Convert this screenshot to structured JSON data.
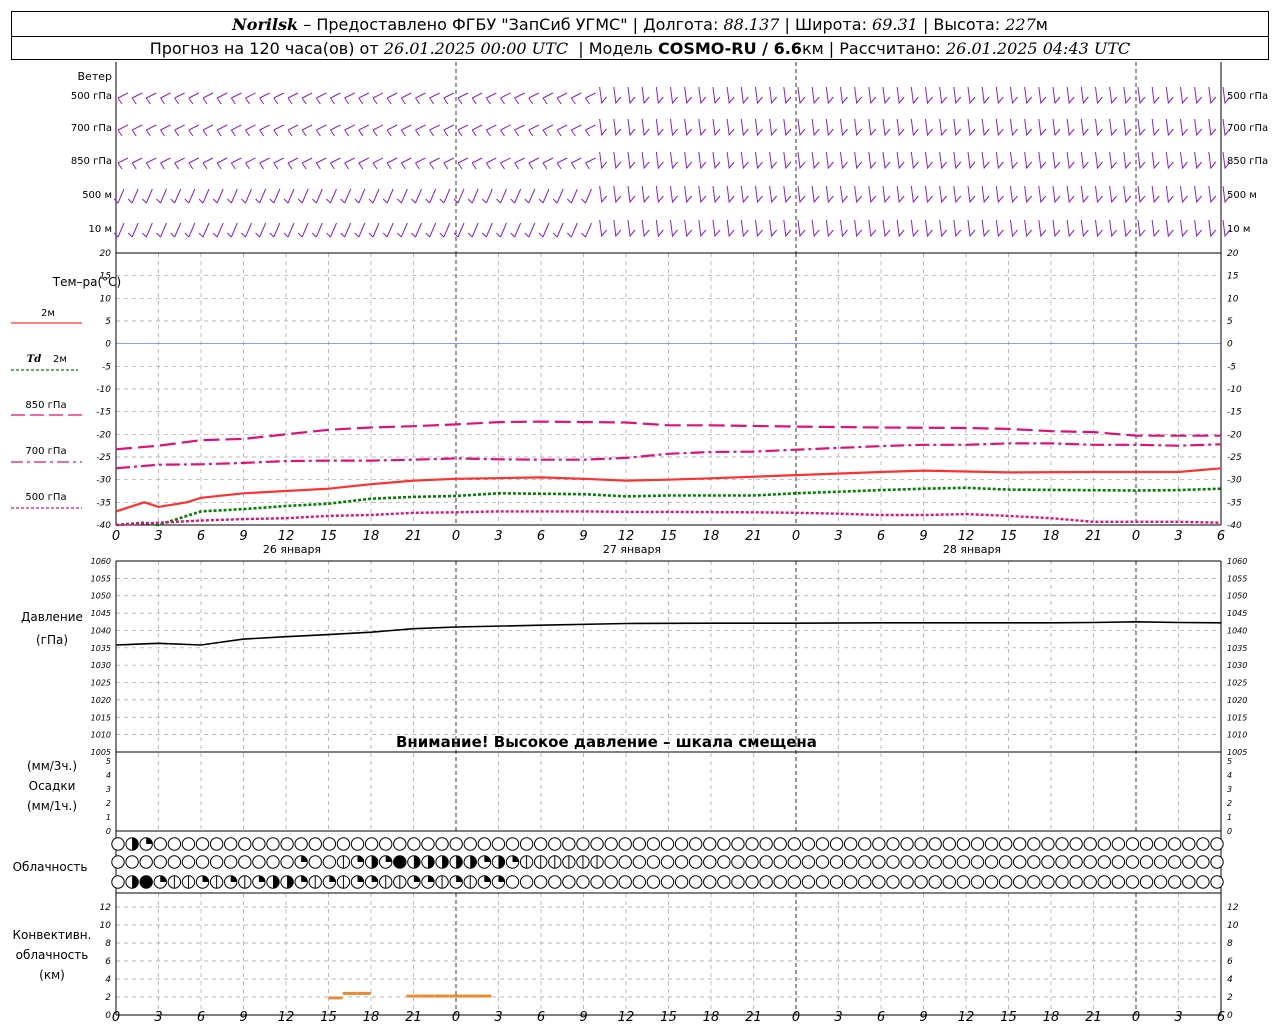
{
  "header": {
    "station": "Norilsk",
    "dash": "–",
    "provider": "Предоставлено ФГБУ \"ЗапСиб УГМС\"",
    "lon_label": "Долгота:",
    "lon": "88.137",
    "lat_label": "Широта:",
    "lat": "69.31",
    "alt_label": "Высота:",
    "alt": "227",
    "alt_unit": "м",
    "forecast_prefix": "Прогноз на 120 часа(ов) от",
    "forecast_from": "26.01.2025 00:00 UTC",
    "model_label": "Модель",
    "model": "COSMO-RU / 6.6",
    "model_unit": "км",
    "calc_label": "Рассчитано:",
    "calc_time": "26.01.2025 04:43 UTC"
  },
  "labels": {
    "wind": "Ветер",
    "levels": [
      "500 гПа",
      "700 гПа",
      "850 гПа",
      "500 м",
      "10 м"
    ],
    "temp": "Тем–ра(°C)",
    "t2m": "2м",
    "td_prefix": "Td",
    "td2m": "2м",
    "t850": "850 гПа",
    "t700": "700 гПа",
    "t500": "500 гПа",
    "pressure": "Давление",
    "pressure_unit": "(гПа)",
    "precip_unit1": "(мм/3ч.)",
    "precip": "Осадки",
    "precip_unit2": "(мм/1ч.)",
    "cloud": "Облачность",
    "conv1": "Конвективн.",
    "conv2": "облачность",
    "conv3": "(км)",
    "warning": "Внимание! Высокое давление – шкала смещена"
  },
  "colors": {
    "t2m": "#ff3030",
    "td2m": "#008000",
    "t850": "#e0107a",
    "t700": "#e0107a",
    "t500": "#e0107a",
    "pressure": "#000000",
    "wind": "#8a1cd0",
    "zero_line": "#4060ff",
    "conv": "#e88a30",
    "grid": "#a0a0a0"
  },
  "chart_data": {
    "type": "line",
    "x_hours": [
      0,
      3,
      6,
      9,
      12,
      15,
      18,
      21,
      24,
      27,
      30,
      33,
      36,
      39,
      42,
      45,
      48,
      51,
      54,
      57,
      60,
      63,
      66,
      69,
      72,
      75,
      78
    ],
    "x_tick_labels": [
      "0",
      "3",
      "6",
      "9",
      "12",
      "15",
      "18",
      "21",
      "0",
      "3",
      "6",
      "9",
      "12",
      "15",
      "18",
      "21",
      "0",
      "3",
      "6",
      "9",
      "12",
      "15",
      "18",
      "21",
      "0",
      "3",
      "6"
    ],
    "day_labels": [
      {
        "hour": 12,
        "text": "26 января"
      },
      {
        "hour": 36,
        "text": "27 января"
      },
      {
        "hour": 60,
        "text": "28 января"
      }
    ],
    "temperature": {
      "ylim": [
        -40,
        20
      ],
      "yticks": [
        20,
        15,
        10,
        5,
        0,
        -5,
        -10,
        -15,
        -20,
        -25,
        -30,
        -35,
        -40
      ],
      "series": [
        {
          "name": "2м",
          "key": "t2m",
          "x": [
            0,
            2,
            3,
            5,
            6,
            9,
            12,
            15,
            18,
            21,
            24,
            30,
            33,
            36,
            39,
            42,
            48,
            54,
            57,
            63,
            69,
            72,
            75,
            78
          ],
          "y": [
            -37,
            -35,
            -36,
            -35,
            -34,
            -33,
            -32.5,
            -32,
            -31,
            -30.2,
            -29.8,
            -29.5,
            -29.8,
            -30.2,
            -30,
            -29.7,
            -29,
            -28.3,
            -28,
            -28.4,
            -28.3,
            -28.3,
            -28.3,
            -27.5
          ]
        },
        {
          "name": "Td 2м",
          "key": "td2m",
          "x": [
            0,
            2,
            3,
            6,
            9,
            12,
            15,
            18,
            21,
            24,
            27,
            33,
            36,
            39,
            45,
            48,
            54,
            57,
            60,
            63,
            72,
            75,
            78
          ],
          "y": [
            -40,
            -39.5,
            -40,
            -37,
            -36.5,
            -35.8,
            -35.3,
            -34.2,
            -33.8,
            -33.6,
            -33,
            -33.2,
            -33.7,
            -33.5,
            -33.5,
            -33,
            -32.3,
            -32,
            -31.8,
            -32.2,
            -32.4,
            -32.3,
            -32
          ]
        },
        {
          "name": "850 гПа",
          "key": "t850",
          "x": [
            0,
            3,
            6,
            9,
            12,
            15,
            18,
            21,
            24,
            27,
            30,
            36,
            39,
            42,
            48,
            54,
            60,
            63,
            66,
            69,
            72,
            75,
            78
          ],
          "y": [
            -23.3,
            -22.5,
            -21.3,
            -21,
            -20,
            -19,
            -18.5,
            -18.2,
            -17.8,
            -17.3,
            -17.2,
            -17.4,
            -18,
            -18,
            -18.3,
            -18.5,
            -18.6,
            -18.8,
            -19.3,
            -19.5,
            -20.3,
            -20.3,
            -20.3
          ]
        },
        {
          "name": "700 гПа",
          "key": "t700",
          "x": [
            0,
            3,
            6,
            9,
            12,
            15,
            18,
            21,
            24,
            27,
            30,
            33,
            36,
            39,
            42,
            45,
            48,
            54,
            57,
            60,
            63,
            66,
            69,
            72,
            75,
            78
          ],
          "y": [
            -27.5,
            -26.7,
            -26.6,
            -26.3,
            -25.9,
            -25.8,
            -25.8,
            -25.6,
            -25.3,
            -25.5,
            -25.6,
            -25.6,
            -25.2,
            -24.3,
            -23.9,
            -23.8,
            -23.4,
            -22.6,
            -22.3,
            -22.3,
            -22.0,
            -22.0,
            -22.3,
            -22.3,
            -22.5,
            -22.2
          ]
        },
        {
          "name": "500 гПа",
          "key": "t500",
          "x": [
            0,
            3,
            6,
            9,
            12,
            15,
            18,
            21,
            24,
            27,
            33,
            36,
            39,
            45,
            48,
            51,
            54,
            57,
            60,
            63,
            66,
            69,
            72,
            75,
            78
          ],
          "y": [
            -40,
            -39.5,
            -39,
            -38.7,
            -38.5,
            -38,
            -37.8,
            -37.3,
            -37.2,
            -37,
            -37,
            -37.1,
            -37.1,
            -37.2,
            -37.3,
            -37.5,
            -37.8,
            -37.8,
            -37.6,
            -38,
            -38.5,
            -39.3,
            -39.3,
            -39.3,
            -39.5
          ]
        }
      ]
    },
    "pressure": {
      "ylim": [
        1005,
        1060
      ],
      "yticks": [
        1060,
        1055,
        1050,
        1045,
        1040,
        1035,
        1030,
        1025,
        1020,
        1015,
        1010,
        1005
      ],
      "x": [
        0,
        3,
        6,
        9,
        12,
        15,
        18,
        21,
        24,
        30,
        36,
        42,
        48,
        54,
        60,
        66,
        69,
        72,
        75,
        78
      ],
      "y": [
        1035.8,
        1036.3,
        1035.8,
        1037.5,
        1038.2,
        1038.8,
        1039.5,
        1040.5,
        1041.0,
        1041.5,
        1042.0,
        1042.1,
        1042.1,
        1042.2,
        1042.2,
        1042.2,
        1042.3,
        1042.5,
        1042.3,
        1042.2
      ]
    },
    "precipitation": {
      "ylim": [
        0,
        5
      ],
      "yticks": [
        5,
        4,
        3,
        2,
        1,
        0
      ],
      "x": [],
      "y": []
    },
    "clouds": {
      "upper": {
        "1": 3,
        "2": 2
      },
      "middle": {
        "13": 2,
        "16": 1,
        "17": 2,
        "18": 3,
        "19": 2,
        "20": 4,
        "21": 3,
        "22": 3,
        "23": 3,
        "24": 3,
        "25": 3,
        "26": 2,
        "27": 3,
        "28": 2,
        "29": 1,
        "30": 1,
        "31": 1,
        "32": 1,
        "33": 1,
        "34": 1
      },
      "lower": {
        "1": 3,
        "2": 4,
        "3": 2,
        "4": 1,
        "5": 1,
        "6": 2,
        "7": 1,
        "8": 2,
        "9": 1,
        "10": 2,
        "11": 3,
        "12": 3,
        "13": 2,
        "14": 1,
        "15": 2,
        "16": 1,
        "17": 2,
        "18": 2,
        "19": 1,
        "20": 1,
        "21": 2,
        "22": 2,
        "23": 1,
        "24": 2,
        "25": 1,
        "26": 2,
        "27": 2
      }
    },
    "convective": {
      "ylim": [
        0,
        13
      ],
      "yticks": [
        12,
        10,
        8,
        6,
        4,
        2,
        0
      ],
      "x": [
        15.5,
        16.5,
        17.5,
        21,
        22,
        23,
        24,
        25,
        26
      ],
      "y": [
        1.9,
        2.4,
        2.4,
        2.1,
        2.1,
        2.1,
        2.1,
        2.1,
        2.1
      ]
    },
    "wind": {
      "rows": [
        "500 гПа",
        "700 гПа",
        "850 гПа",
        "500 м",
        "10 м"
      ]
    }
  }
}
